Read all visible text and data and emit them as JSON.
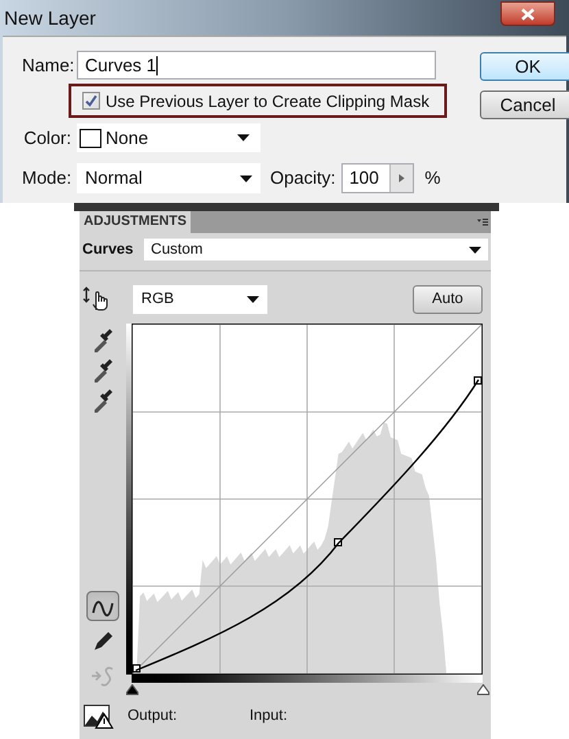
{
  "dialog": {
    "title": "New Layer",
    "name": {
      "label": "Name:",
      "value": "Curves 1"
    },
    "clipping": {
      "label": "Use Previous Layer to Create Clipping Mask",
      "checked": true
    },
    "color": {
      "label": "Color:",
      "value": "None"
    },
    "mode": {
      "label": "Mode:",
      "value": "Normal"
    },
    "opacity": {
      "label": "Opacity:",
      "value": "100",
      "unit": "%"
    },
    "buttons": [
      {
        "label": "OK",
        "default": true
      },
      {
        "label": "Cancel",
        "default": false
      }
    ]
  },
  "panel": {
    "tab": "ADJUSTMENTS",
    "adjustment": "Curves",
    "preset": "Custom",
    "channel": "RGB",
    "auto_button": "Auto",
    "tools": [
      {
        "kind": "curve",
        "selected": true,
        "disabled": false
      },
      {
        "kind": "pencil",
        "selected": false,
        "disabled": false
      },
      {
        "kind": "smooth",
        "selected": false,
        "disabled": true
      }
    ],
    "input_sliders": [
      {
        "level": 0
      },
      {
        "level": 1
      }
    ],
    "output_label": "Output:",
    "input_label": "Input:"
  }
}
